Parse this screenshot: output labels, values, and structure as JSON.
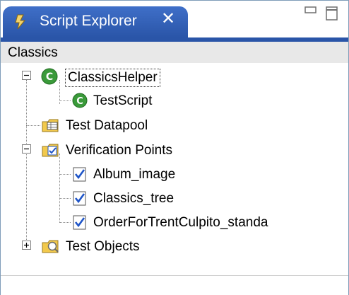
{
  "window": {
    "title": "Script Explorer",
    "close_glyph": "✕",
    "icons": {
      "logo": "script-explorer-icon",
      "minimize": "minimize-icon",
      "maximize": "maximize-icon"
    }
  },
  "toolbar": {
    "project": "Classics"
  },
  "tree": {
    "helper": {
      "label": "ClassicsHelper",
      "expanded": true
    },
    "helper_child": {
      "label": "TestScript"
    },
    "datapool": {
      "label": "Test Datapool"
    },
    "vp": {
      "label": "Verification Points",
      "expanded": true
    },
    "vp_items": [
      {
        "label": "Album_image"
      },
      {
        "label": "Classics_tree"
      },
      {
        "label": "OrderForTrentCulpito_standa"
      }
    ],
    "objects": {
      "label": "Test Objects",
      "expanded": false
    }
  },
  "colors": {
    "tab": "#2a55a8",
    "helper_green": "#3a9a3a",
    "check_blue": "#1f55c8"
  }
}
